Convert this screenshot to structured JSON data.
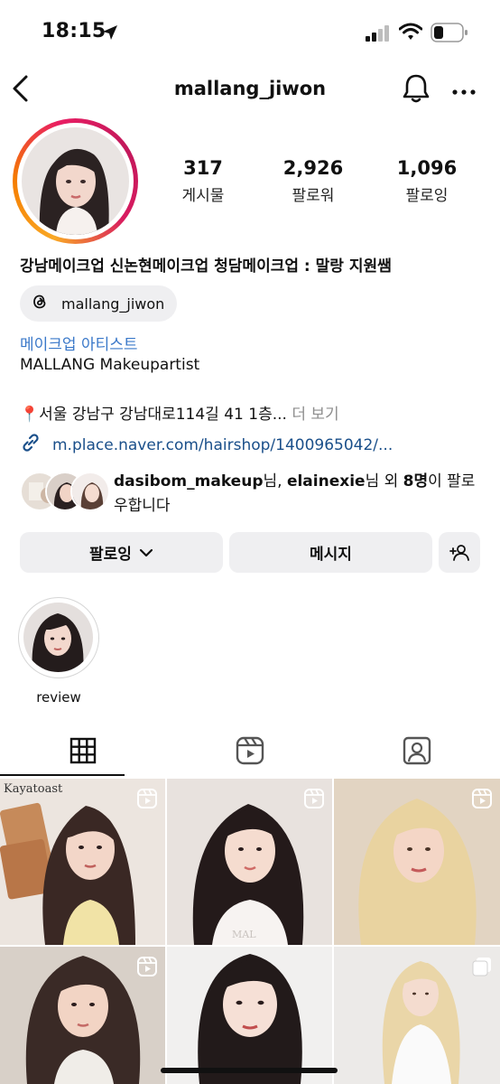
{
  "status_bar": {
    "time": "18:15"
  },
  "header": {
    "username": "mallang_jiwon"
  },
  "profile": {
    "stats": [
      {
        "value": "317",
        "label": "게시물"
      },
      {
        "value": "2,926",
        "label": "팔로워"
      },
      {
        "value": "1,096",
        "label": "팔로잉"
      }
    ],
    "full_name": "강남메이크업 신논현메이크업 청담메이크업 : 말랑 지원쌤",
    "threads_handle": "mallang_jiwon",
    "category": "메이크업 아티스트",
    "bio": "MALLANG Makeupartist",
    "location": {
      "icon": "📍",
      "text": "서울 강남구 강남대로114길 41 1층...",
      "more": " 더 보기"
    },
    "link": "m.place.naver.com/hairshop/1400965042/...",
    "followed_by": {
      "user1": "dasibom_makeup",
      "sep1": "님, ",
      "user2": "elainexie",
      "mid": "님 외 ",
      "count": "8명",
      "tail": "이 팔로우합니다"
    }
  },
  "actions": {
    "follow_label": "팔로잉",
    "message_label": "메시지"
  },
  "highlights": [
    {
      "label": "review"
    }
  ],
  "tabs": [
    "grid-icon",
    "reels-icon",
    "tagged-icon"
  ],
  "grid": {
    "brand_text": "Kayatoast"
  },
  "colors": {
    "link": "#1a4f8a",
    "category": "#3a78c9",
    "button_bg": "#efeff1"
  }
}
